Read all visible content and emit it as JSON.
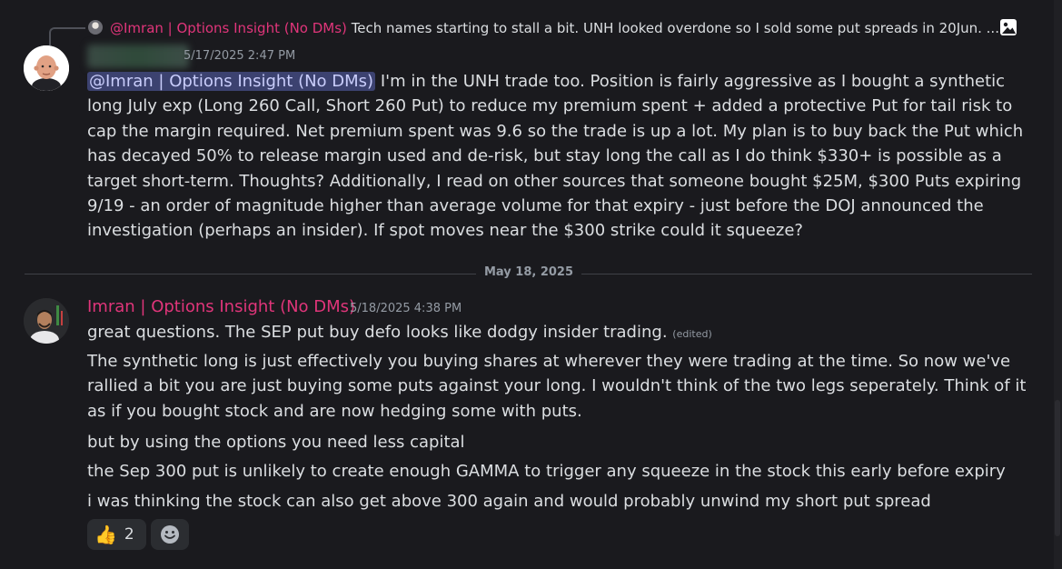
{
  "reply": {
    "author": "@Imran | Options Insight (No DMs)",
    "text": "Tech names starting to stall a bit.  UNH looked overdone so I sold some put spreads in 20Jun. ..."
  },
  "message1": {
    "author": "",
    "timestamp": "5/17/2025 2:47 PM",
    "mention": "@Imran | Options Insight (No DMs)",
    "text": " I'm in the UNH trade too. Position is fairly aggressive  as I bought a synthetic long July exp (Long 260 Call, Short 260 Put) to reduce my premium spent + added a protective Put for tail risk to cap the margin required. Net premium spent was 9.6 so the trade is up a lot. My plan is to buy back the Put which has decayed 50% to release margin used and de-risk, but stay long the call as I do think $330+ is possible as a target short-term. Thoughts? Additionally, I read on other sources that someone bought $25M, $300 Puts expiring 9/19  - an order of magnitude higher than average volume for that expiry - just before the DOJ announced the investigation (perhaps an insider). If  spot moves near the $300 strike could it squeeze?"
  },
  "divider": {
    "date": "May 18, 2025"
  },
  "message2": {
    "author": "Imran | Options Insight (No DMs)",
    "timestamp": "5/18/2025 4:38 PM",
    "line1": "great questions.  The SEP put buy defo looks like dodgy insider trading.",
    "edited": "(edited)",
    "line2": "The synthetic long is just effectively you buying shares at wherever they were trading at the time.  So now we've rallied a bit you are just buying some puts against your long.  I wouldn't think of the two legs seperately.  Think of it as if you bought stock and are now hedging some with puts.",
    "line3": "but by using the options you need less capital",
    "line4": "the Sep 300 put is unlikely to create enough GAMMA to trigger any squeeze in the stock this early before expiry",
    "line5": "i was thinking the stock can also get above 300 again and would probably unwind my short put spread"
  },
  "reactions": [
    {
      "emoji": "👍",
      "count": "2"
    }
  ],
  "icons": {
    "reply_image": "image-icon",
    "add_reaction": "smile-add-reaction-icon"
  },
  "colors": {
    "author_pink": "#e0357a",
    "mention_bg": "#3c4270",
    "background": "#1a1a1e"
  }
}
